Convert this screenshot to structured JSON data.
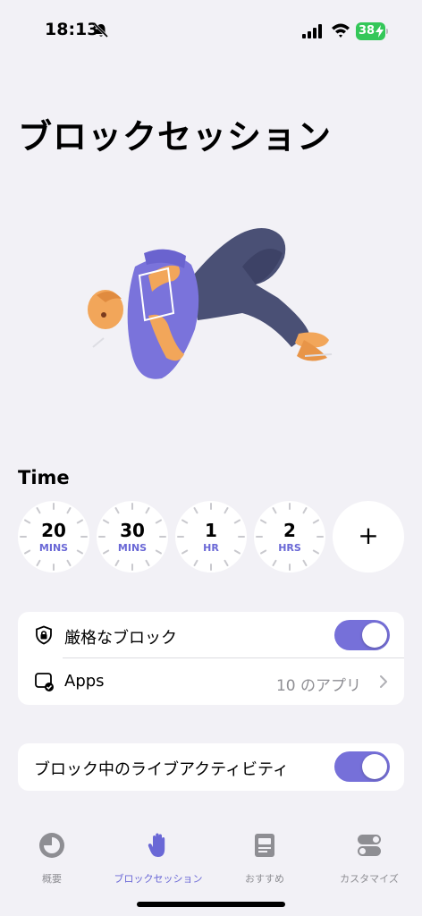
{
  "status_bar": {
    "time": "18:13",
    "battery": "38"
  },
  "page_title": "ブロックセッション",
  "time_section": {
    "title": "Time",
    "presets": [
      {
        "value": "20",
        "unit": "MINS"
      },
      {
        "value": "30",
        "unit": "MINS"
      },
      {
        "value": "1",
        "unit": "HR"
      },
      {
        "value": "2",
        "unit": "HRS"
      }
    ],
    "add_label": "+"
  },
  "settings": {
    "strict_block_label": "厳格なブロック",
    "strict_block_on": true,
    "apps_label": "Apps",
    "apps_value": "10 のアプリ",
    "live_activity_label": "ブロック中のライブアクティビティ",
    "live_activity_on": true
  },
  "tabs": [
    {
      "label": "概要",
      "icon": "overview-icon"
    },
    {
      "label": "ブロックセッション",
      "icon": "hand-icon",
      "active": true
    },
    {
      "label": "おすすめ",
      "icon": "document-icon"
    },
    {
      "label": "カスタマイズ",
      "icon": "toggles-icon"
    }
  ],
  "colors": {
    "accent": "#7670d9",
    "accent_text": "#6a68d6",
    "background": "#f2f1f6",
    "battery": "#34c759"
  }
}
